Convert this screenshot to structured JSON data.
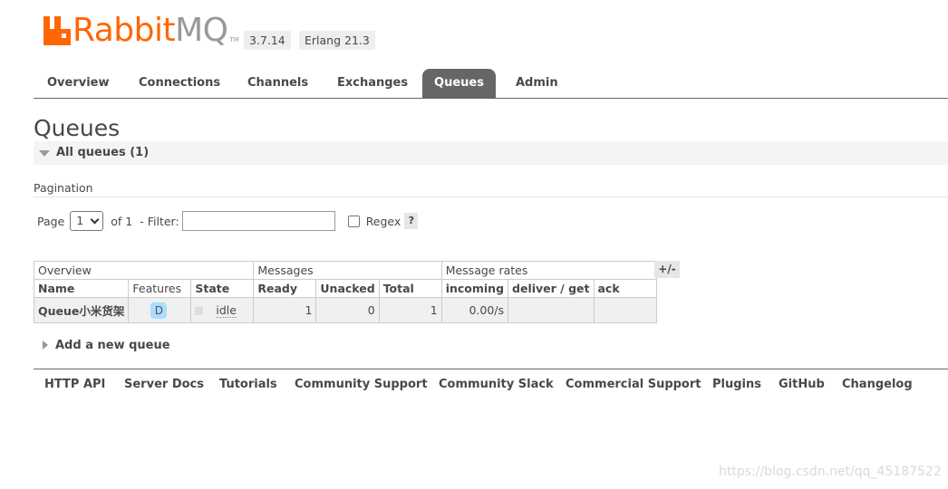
{
  "header": {
    "logo_text_rabbit": "Rabbit",
    "logo_text_mq": "MQ",
    "logo_tm": "TM",
    "version": "3.7.14",
    "erlang": "Erlang 21.3"
  },
  "tabs": [
    {
      "label": "Overview"
    },
    {
      "label": "Connections"
    },
    {
      "label": "Channels"
    },
    {
      "label": "Exchanges"
    },
    {
      "label": "Queues",
      "active": true
    },
    {
      "label": "Admin"
    }
  ],
  "page": {
    "title": "Queues",
    "section_title": "All queues (1)"
  },
  "pagination": {
    "label": "Pagination",
    "page_label": "Page",
    "page_value": "1",
    "of_text": "of 1",
    "filter_label": "- Filter:",
    "filter_value": "",
    "regex_label": "Regex",
    "regex_checked": false,
    "help": "?"
  },
  "table": {
    "groups": [
      "Overview",
      "Messages",
      "Message rates"
    ],
    "columns": [
      "Name",
      "Features",
      "State",
      "Ready",
      "Unacked",
      "Total",
      "incoming",
      "deliver / get",
      "ack"
    ],
    "rows": [
      {
        "name": "Queue小米货架",
        "feature": "D",
        "state": "idle",
        "ready": "1",
        "unacked": "0",
        "total": "1",
        "incoming": "0.00/s",
        "deliver_get": "",
        "ack": ""
      }
    ],
    "toggle": "+/-"
  },
  "add_queue": "Add a new queue",
  "footer": {
    "links": [
      "HTTP API",
      "Server Docs",
      "Tutorials",
      "Community Support",
      "Community Slack",
      "Commercial Support",
      "Plugins",
      "GitHub",
      "Changelog"
    ]
  },
  "watermark": "https://blog.csdn.net/qq_45187522",
  "colors": {
    "brand_orange": "#ff6600",
    "active_tab": "#666666",
    "durable_badge": "#aaddff"
  }
}
